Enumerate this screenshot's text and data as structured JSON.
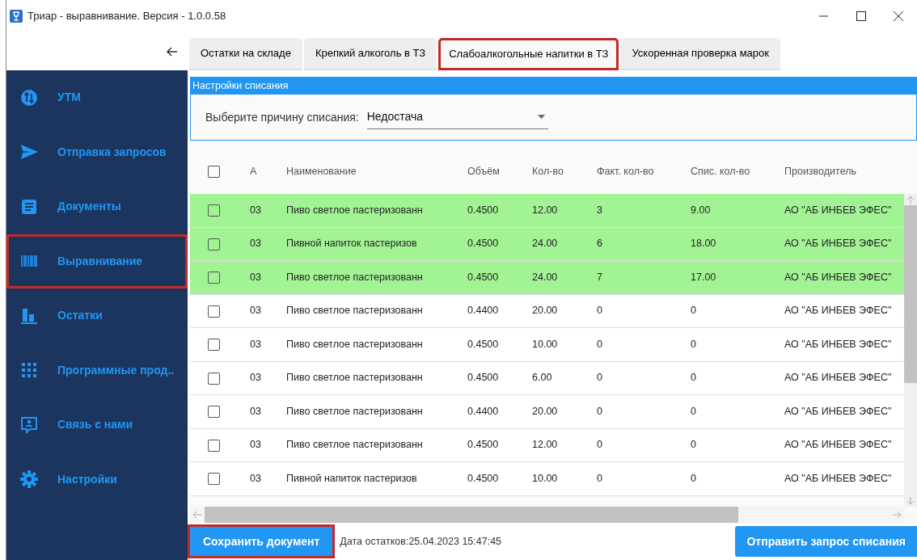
{
  "window": {
    "title": "Триар - выравнивание. Версия - 1.0.0.58"
  },
  "sidebar": {
    "items": [
      {
        "label": "УТМ",
        "selected": false
      },
      {
        "label": "Отправка запросов",
        "selected": false
      },
      {
        "label": "Документы",
        "selected": false
      },
      {
        "label": "Выравнивание",
        "selected": true
      },
      {
        "label": "Остатки",
        "selected": false
      },
      {
        "label": "Программные прод..",
        "selected": false
      },
      {
        "label": "Связь с нами",
        "selected": false
      },
      {
        "label": "Настройки",
        "selected": false
      }
    ]
  },
  "tabs": [
    {
      "label": "Остатки на складе",
      "selected": false
    },
    {
      "label": "Крепкий алкоголь в ТЗ",
      "selected": false
    },
    {
      "label": "Слабоалкогольные напитки в ТЗ",
      "selected": true
    },
    {
      "label": "Ускоренная проверка марок",
      "selected": false
    }
  ],
  "settings": {
    "title": "Настройки списания",
    "reason_label": "Выберите причину списания:",
    "reason_value": "Недостача"
  },
  "table": {
    "header_checked": false,
    "columns": [
      "А",
      "Наименование",
      "Объём",
      "Кол-во",
      "Факт. кол-во",
      "Спис. кол-во",
      "Производитель"
    ],
    "rows": [
      {
        "checked": false,
        "highlighted": true,
        "cells": [
          "03",
          "Пиво светлое пастеризованн",
          "0.4500",
          "12.00",
          "3",
          "9.00",
          "АО \"АБ ИНБЕВ ЭФЕС\""
        ]
      },
      {
        "checked": false,
        "highlighted": true,
        "cells": [
          "03",
          "Пивной напиток пастеризов",
          "0.4500",
          "24.00",
          "6",
          "18.00",
          "АО \"АБ ИНБЕВ ЭФЕС\""
        ]
      },
      {
        "checked": false,
        "highlighted": true,
        "cells": [
          "03",
          "Пиво светлое пастеризованн",
          "0.4500",
          "24.00",
          "7",
          "17.00",
          "АО \"АБ ИНБЕВ ЭФЕС\""
        ]
      },
      {
        "checked": false,
        "highlighted": false,
        "cells": [
          "03",
          "Пиво светлое пастеризованн",
          "0.4400",
          "20.00",
          "0",
          "0",
          "АО \"АБ ИНБЕВ ЭФЕС\""
        ]
      },
      {
        "checked": false,
        "highlighted": false,
        "cells": [
          "03",
          "Пиво светлое пастеризованн",
          "0.4500",
          "10.00",
          "0",
          "0",
          "АО \"АБ ИНБЕВ ЭФЕС\""
        ]
      },
      {
        "checked": false,
        "highlighted": false,
        "cells": [
          "03",
          "Пиво светлое пастеризованн",
          "0.4500",
          "6.00",
          "0",
          "0",
          "АО \"АБ ИНБЕВ ЭФЕС\""
        ]
      },
      {
        "checked": false,
        "highlighted": false,
        "cells": [
          "03",
          "Пиво светлое пастеризованн",
          "0.4400",
          "20.00",
          "0",
          "0",
          "АО \"АБ ИНБЕВ ЭФЕС\""
        ]
      },
      {
        "checked": false,
        "highlighted": false,
        "cells": [
          "03",
          "Пиво светлое пастеризованн",
          "0.4500",
          "12.00",
          "0",
          "0",
          "АО \"АБ ИНБЕВ ЭФЕС\""
        ]
      },
      {
        "checked": false,
        "highlighted": false,
        "cells": [
          "03",
          "Пивной напиток пастеризов",
          "0.4500",
          "10.00",
          "0",
          "0",
          "АО \"АБ ИНБЕВ ЭФЕС\""
        ]
      }
    ]
  },
  "footer": {
    "save_button": "Сохранить документ",
    "save_highlighted": true,
    "date_text": "Дата остатков:25.04.2023 15:47:45",
    "send_button": "Отправить запрос списания"
  }
}
